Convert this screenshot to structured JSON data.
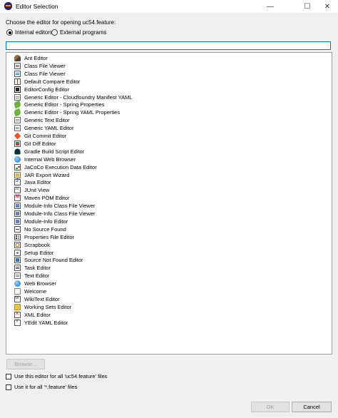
{
  "window": {
    "title": "Editor Selection",
    "controls": {
      "minimize": "—",
      "maximize": "☐",
      "close": "✕"
    }
  },
  "prompt": "Choose the editor for opening uc54.feature:",
  "radio": {
    "internal": {
      "label": "Internal editors",
      "selected": true
    },
    "external": {
      "label": "External programs",
      "selected": false
    }
  },
  "filter": {
    "value": ""
  },
  "editors": [
    {
      "label": "Ant Editor",
      "icon": "ant-icon"
    },
    {
      "label": "Class File Viewer",
      "icon": "class-file-icon"
    },
    {
      "label": "Class File Viewer",
      "icon": "class-file-icon"
    },
    {
      "label": "Default Compare Editor",
      "icon": "compare-icon"
    },
    {
      "label": "EditorConfig Editor",
      "icon": "editorconfig-icon"
    },
    {
      "label": "Generic Editor - Cloudfoundry Manifest YAML",
      "icon": "text-document-icon"
    },
    {
      "label": "Generic Editor - Spring Properties",
      "icon": "spring-leaf-icon"
    },
    {
      "label": "Generic Editor - Spring YAML Properties",
      "icon": "spring-leaf-icon"
    },
    {
      "label": "Generic Text Editor",
      "icon": "text-document-icon"
    },
    {
      "label": "Generic YAML Editor",
      "icon": "text-document-icon"
    },
    {
      "label": "Git Commit Editor",
      "icon": "git-icon"
    },
    {
      "label": "Git Diff Editor",
      "icon": "git-diff-icon"
    },
    {
      "label": "Gradle Build Script Editor",
      "icon": "gradle-icon"
    },
    {
      "label": "Internal Web Browser",
      "icon": "globe-icon"
    },
    {
      "label": "JaCoCo Execution Data Editor",
      "icon": "jacoco-icon"
    },
    {
      "label": "JAR Export Wizard",
      "icon": "jar-icon"
    },
    {
      "label": "Java Editor",
      "icon": "java-icon"
    },
    {
      "label": "JUnit View",
      "icon": "junit-icon"
    },
    {
      "label": "Maven POM Editor",
      "icon": "maven-icon"
    },
    {
      "label": "Module-Info Class File Viewer",
      "icon": "module-icon"
    },
    {
      "label": "Module-Info Class File Viewer",
      "icon": "module-icon"
    },
    {
      "label": "Module-Info Editor",
      "icon": "module-icon"
    },
    {
      "label": "No Source Found",
      "icon": "no-source-icon"
    },
    {
      "label": "Properties File Editor",
      "icon": "properties-icon"
    },
    {
      "label": "Scrapbook",
      "icon": "scrapbook-icon"
    },
    {
      "label": "Setup Editor",
      "icon": "setup-icon"
    },
    {
      "label": "Source Not Found Editor",
      "icon": "source-not-found-icon"
    },
    {
      "label": "Task Editor",
      "icon": "task-icon"
    },
    {
      "label": "Text Editor",
      "icon": "text-document-icon"
    },
    {
      "label": "Web Browser",
      "icon": "globe-icon"
    },
    {
      "label": "Welcome",
      "icon": "welcome-icon"
    },
    {
      "label": "WikiText Editor",
      "icon": "wikitext-icon"
    },
    {
      "label": "Working Sets Editor",
      "icon": "folder-icon"
    },
    {
      "label": "XML Editor",
      "icon": "xml-icon"
    },
    {
      "label": "YEdit YAML Editor",
      "icon": "yedit-icon"
    }
  ],
  "browse_label": "Browse...",
  "checkboxes": {
    "use_for_file": {
      "label": "Use this editor for all 'uc54.feature' files",
      "checked": false
    },
    "use_for_ext": {
      "label": "Use it for all '*.feature' files",
      "checked": false
    }
  },
  "buttons": {
    "ok": "OK",
    "cancel": "Cancel"
  }
}
